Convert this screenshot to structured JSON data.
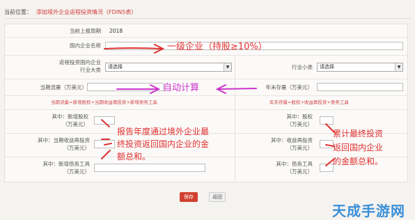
{
  "breadcrumb": {
    "prefix": "当前位置：",
    "title": "添加境外企业返程投资情况（FDIN5表）"
  },
  "form": {
    "report_period_label": "当前上报周期",
    "report_period_value": "2018",
    "domestic_company_label": "国内企业名称",
    "industry_major_label_1": "返程投资国内企业",
    "industry_major_label_2": "行业大类",
    "industry_major_value": "请选择",
    "industry_minor_label": "行业小类",
    "industry_minor_value": "请选择",
    "current_flow_label": "当期流量（万美元）",
    "year_end_stock_label": "年末存量（万美元）",
    "flow_hint": "当期流量=新增股权+当期收益再投资+新增债务工具",
    "stock_hint": "年末存量=股权+收益再投资+债务工具",
    "new_equity_label_1": "其中：新增股权",
    "new_equity_label_2": "（万美元）",
    "reinvest_label_1": "其中：当期收益再投资",
    "reinvest_label_2": "（万美元）",
    "new_debt_label_1": "其中：新增债务工具",
    "new_debt_label_2": "（万美元）",
    "equity_label_1": "其中：股权",
    "equity_label_2": "（万美元）",
    "income_reinvest_label_1": "其中：收益再投资",
    "income_reinvest_label_2": "（万美元）",
    "debt_label_1": "其中：债务工具",
    "debt_label_2": "（万美元）"
  },
  "annotations": {
    "first_level": "一级企业（持股≥10%）",
    "auto_calc": "自动计算",
    "left_note": [
      "报告年度通过境外企业最",
      "终投资返回国内企业的金",
      "额总和。"
    ],
    "right_note": [
      "累计最终投资",
      "返回国内企业",
      "的金额总和。"
    ]
  },
  "buttons": {
    "save": "保存",
    "back": "返回"
  },
  "watermark": "天成手游网",
  "colors": {
    "annotation_red": "#e03030",
    "annotation_pink": "#cc33cc",
    "save_button": "#d0402e",
    "watermark_blue": "#3a8fd8"
  }
}
